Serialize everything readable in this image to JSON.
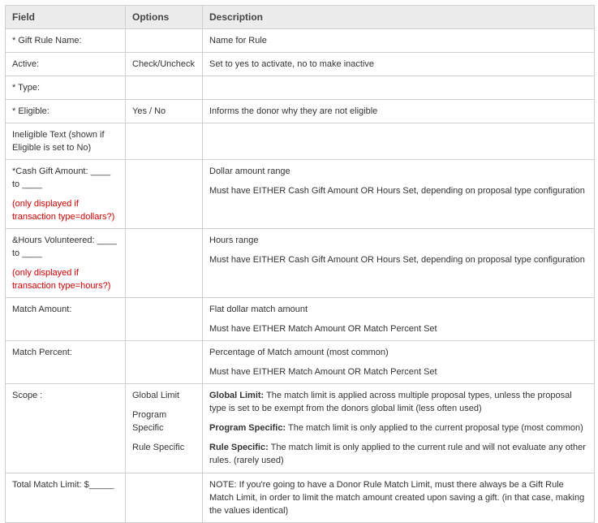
{
  "headers": [
    "Field",
    "Options",
    "Description"
  ],
  "rows": {
    "gift_rule_name": {
      "field": "* Gift Rule Name:",
      "options": "",
      "description": "Name for Rule"
    },
    "active": {
      "field": "Active:",
      "options": "Check/Uncheck",
      "description": "Set to yes to activate, no to make inactive"
    },
    "type": {
      "field": "* Type:",
      "options": "",
      "description": ""
    },
    "eligible": {
      "field": "* Eligible:",
      "options": "Yes / No",
      "description": "Informs the donor why they are not eligible"
    },
    "ineligible_text": {
      "field_line1": "Ineligible Text (shown if",
      "field_line2": "Eligible is set to No)",
      "options": "",
      "description": ""
    },
    "cash_gift": {
      "field_line1": "*Cash Gift Amount: ____",
      "field_line2": "to  ____",
      "note_line1": "(only displayed if",
      "note_line2": "transaction type=dollars?)",
      "desc1": "Dollar amount range",
      "desc2": "Must have EITHER Cash Gift Amount OR Hours Set, depending on proposal type configuration"
    },
    "hours_volunteered": {
      "field_line1": "&Hours Volunteered: ____",
      "field_line2": "to  ____",
      "note_line1": "(only displayed if",
      "note_line2": "transaction type=hours?)",
      "desc1": "Hours range",
      "desc2": "Must have EITHER Cash Gift Amount OR Hours Set, depending on proposal type configuration"
    },
    "match_amount": {
      "field": "Match Amount:",
      "desc1": "Flat dollar match amount",
      "desc2": "Must have EITHER Match Amount OR Match Percent Set"
    },
    "match_percent": {
      "field": "Match Percent:",
      "desc1": "Percentage of Match amount (most common)",
      "desc2": "Must have EITHER Match Amount OR Match Percent Set"
    },
    "scope": {
      "field": "Scope :",
      "opt1": "Global Limit",
      "opt2_line1": "Program",
      "opt2_line2": "Specific",
      "opt3": "Rule Specific",
      "global_label": "Global Limit:",
      "global_text": " The match limit is applied across multiple proposal types, unless the proposal type is set to be exempt from the donors global limit (less often used)",
      "program_label": "Program Specific:",
      "program_text": " The match limit is only applied to the current proposal type (most common)",
      "rule_label": "Rule Specific:",
      "rule_text": " The match limit is only applied to the current rule and will not evaluate any other rules. (rarely used)"
    },
    "total_match_limit": {
      "field": "Total Match Limit: $_____",
      "description": "NOTE: If you're going to have a Donor Rule Match Limit, must there always be a Gift Rule Match Limit, in order to limit the match amount created upon saving a gift. (in that case, making the values identical)"
    }
  }
}
